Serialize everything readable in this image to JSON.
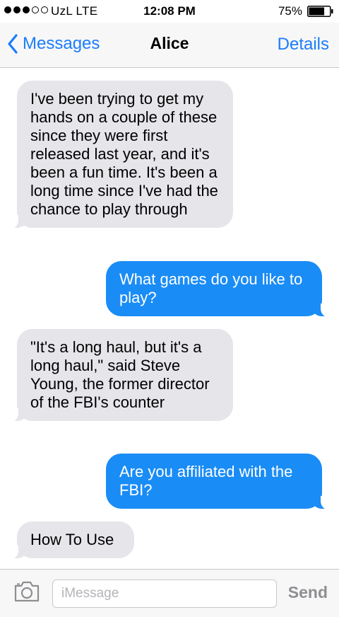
{
  "status_bar": {
    "carrier": "UzL",
    "network": "LTE",
    "time": "12:08 PM",
    "battery_percent": "75%",
    "battery_level": 0.75,
    "signal_bars_filled": 3,
    "signal_bars_total": 5
  },
  "nav": {
    "back_label": "Messages",
    "title": "Alice",
    "details_label": "Details"
  },
  "colors": {
    "accent": "#1a7dfb",
    "outgoing_bubble": "#1a8cf6",
    "incoming_bubble": "#e5e5ea"
  },
  "messages": [
    {
      "direction": "incoming",
      "text": "I've been trying to get my hands on a couple of these since they were first released last year, and it's been a fun time. It's been a long time since I've had the chance to play through"
    },
    {
      "direction": "outgoing",
      "text": "What games do you like to play?"
    },
    {
      "direction": "incoming",
      "text": "\"It's a long haul, but it's a long haul,\" said Steve Young, the former director of the FBI's counter"
    },
    {
      "direction": "outgoing",
      "text": "Are you affiliated with the FBI?"
    },
    {
      "direction": "incoming",
      "text": "How To Use"
    }
  ],
  "composer": {
    "placeholder": "iMessage",
    "value": "",
    "send_label": "Send",
    "camera_icon": "camera-icon"
  }
}
